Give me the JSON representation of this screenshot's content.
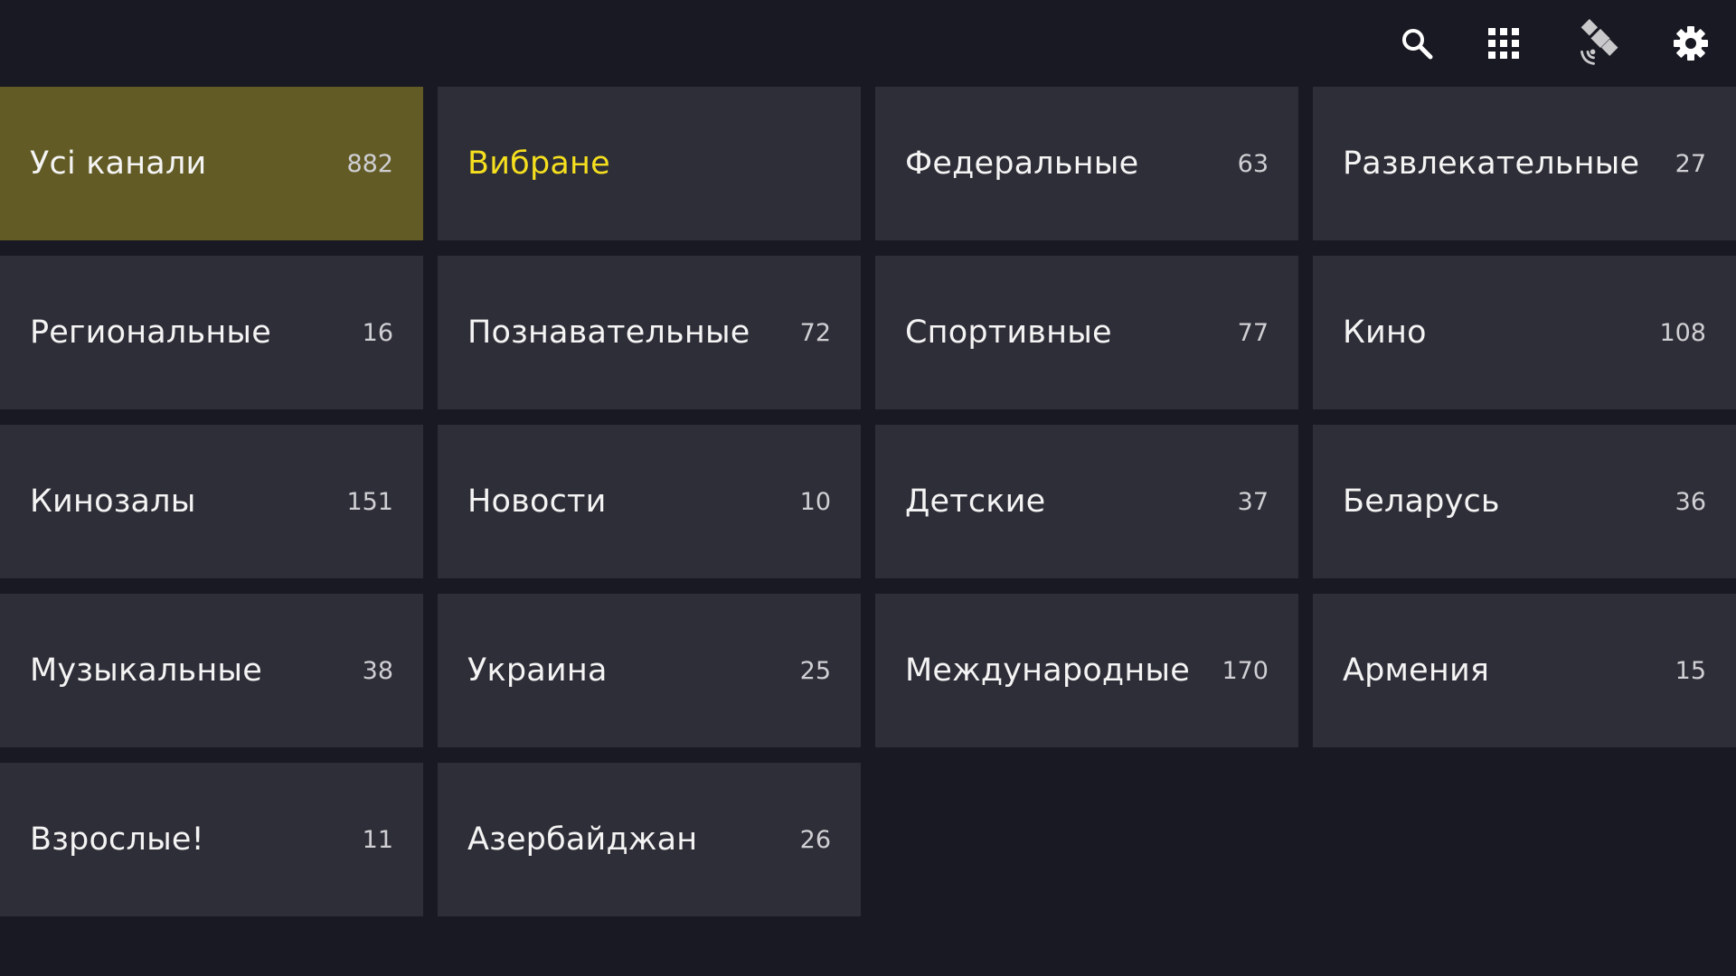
{
  "topbar": {
    "icons": [
      {
        "name": "search-icon"
      },
      {
        "name": "apps-grid-icon"
      },
      {
        "name": "satellite-icon"
      },
      {
        "name": "gear-icon"
      }
    ]
  },
  "colors": {
    "background": "#181922",
    "tile": "#2e2e38",
    "tile_active": "#635b25",
    "favorite_text": "#f5df1e",
    "text": "#f4f4f4",
    "count_text": "#cfcfd4"
  },
  "categories": [
    {
      "label": "Усі канали",
      "count": "882",
      "active": true
    },
    {
      "label": "Вибране",
      "count": "",
      "favorite": true
    },
    {
      "label": "Федеральные",
      "count": "63"
    },
    {
      "label": "Развлекательные",
      "count": "27"
    },
    {
      "label": "Региональные",
      "count": "16"
    },
    {
      "label": "Познавательные",
      "count": "72"
    },
    {
      "label": "Спортивные",
      "count": "77"
    },
    {
      "label": "Кино",
      "count": "108"
    },
    {
      "label": "Кинозалы",
      "count": "151"
    },
    {
      "label": "Новости",
      "count": "10"
    },
    {
      "label": "Детские",
      "count": "37"
    },
    {
      "label": "Беларусь",
      "count": "36"
    },
    {
      "label": "Музыкальные",
      "count": "38"
    },
    {
      "label": "Украина",
      "count": "25"
    },
    {
      "label": "Международные",
      "count": "170"
    },
    {
      "label": "Армения",
      "count": "15"
    },
    {
      "label": "Взрослые!",
      "count": "11"
    },
    {
      "label": "Азербайджан",
      "count": "26"
    }
  ]
}
